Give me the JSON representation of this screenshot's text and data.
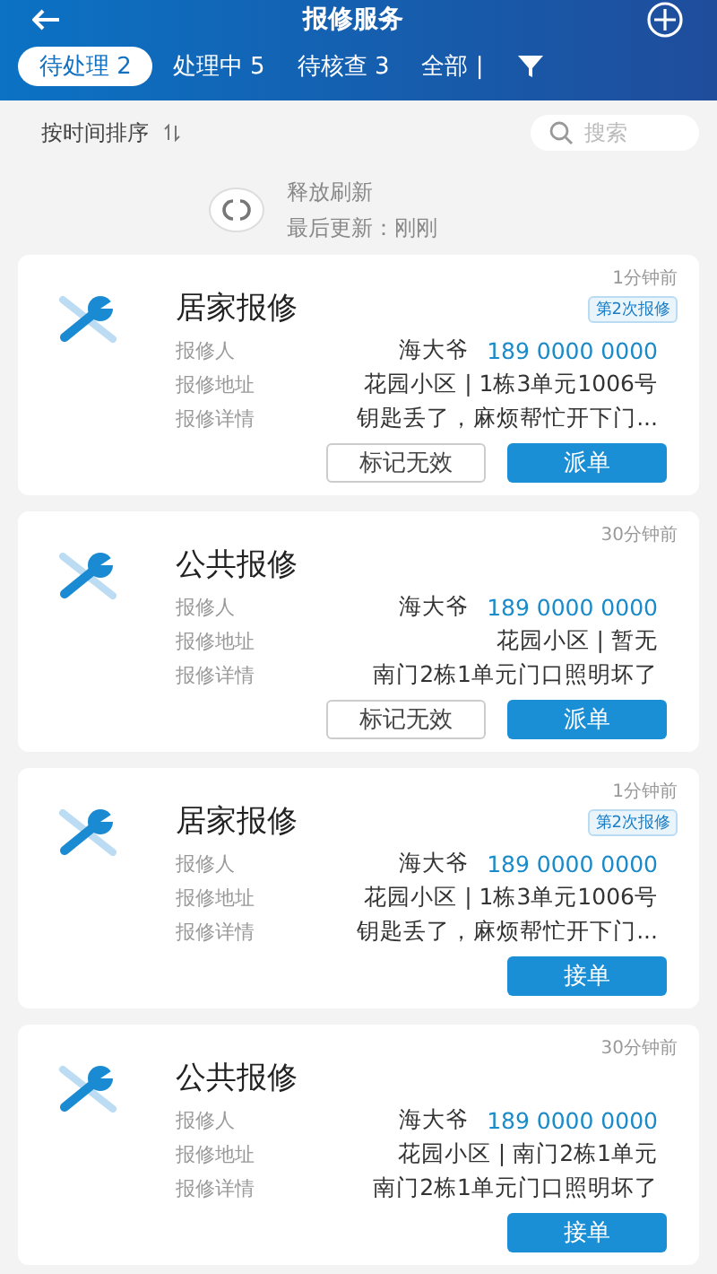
{
  "header": {
    "title": "报修服务"
  },
  "tabs": [
    {
      "label": "待处理 2",
      "selected": true
    },
    {
      "label": "处理中 5",
      "selected": false
    },
    {
      "label": "待核查 3",
      "selected": false
    },
    {
      "label": "全部 |",
      "selected": false
    }
  ],
  "toolbar": {
    "sort_label": "按时间排序",
    "search": {
      "placeholder": "搜索"
    }
  },
  "refresh": {
    "status": "释放刷新",
    "updated": "最后更新：刚刚"
  },
  "cards": [
    {
      "title": "居家报修",
      "time": "1分钟前",
      "badge": "第2次报修",
      "fields": [
        {
          "label": "报修人",
          "value": "海大爷",
          "phone": "189 0000 0000"
        },
        {
          "label": "报修地址",
          "value": "花园小区 | 1栋3单元1006号"
        },
        {
          "label": "报修详情",
          "value": "钥匙丢了，麻烦帮忙开下门..."
        }
      ],
      "buttons": [
        {
          "label": "标记无效",
          "kind": "secondary"
        },
        {
          "label": "派单",
          "kind": "primary"
        }
      ]
    },
    {
      "title": "公共报修",
      "time": "30分钟前",
      "fields": [
        {
          "label": "报修人",
          "value": "海大爷",
          "phone": "189 0000 0000"
        },
        {
          "label": "报修地址",
          "value": "花园小区 | 暂无"
        },
        {
          "label": "报修详情",
          "value": "南门2栋1单元门口照明坏了"
        }
      ],
      "buttons": [
        {
          "label": "标记无效",
          "kind": "secondary"
        },
        {
          "label": "派单",
          "kind": "primary"
        }
      ]
    },
    {
      "title": "居家报修",
      "time": "1分钟前",
      "badge": "第2次报修",
      "fields": [
        {
          "label": "报修人",
          "value": "海大爷",
          "phone": "189 0000 0000"
        },
        {
          "label": "报修地址",
          "value": "花园小区 | 1栋3单元1006号"
        },
        {
          "label": "报修详情",
          "value": "钥匙丢了，麻烦帮忙开下门..."
        }
      ],
      "buttons": [
        {
          "label": "接单",
          "kind": "primary"
        }
      ]
    },
    {
      "title": "公共报修",
      "time": "30分钟前",
      "fields": [
        {
          "label": "报修人",
          "value": "海大爷",
          "phone": "189 0000 0000"
        },
        {
          "label": "报修地址",
          "value": "花园小区 | 南门2栋1单元"
        },
        {
          "label": "报修详情",
          "value": "南门2栋1单元门口照明坏了"
        }
      ],
      "buttons": [
        {
          "label": "接单",
          "kind": "primary"
        }
      ]
    }
  ]
}
